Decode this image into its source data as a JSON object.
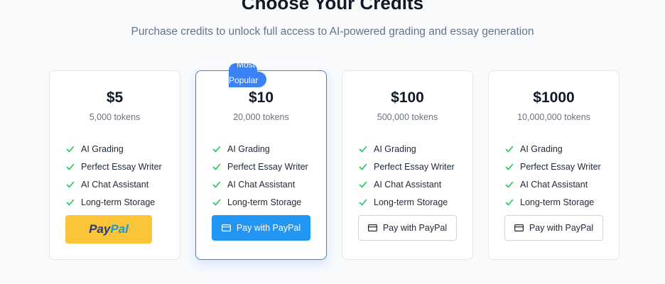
{
  "header": {
    "title": "Choose Your Credits",
    "subtitle": "Purchase credits to unlock full access to AI-powered grading and essay generation"
  },
  "plans": [
    {
      "price": "$5",
      "tokens": "5,000 tokens",
      "features": [
        "AI Grading",
        "Perfect Essay Writer",
        "AI Chat Assistant",
        "Long-term Storage"
      ],
      "button": {
        "pay": "Pay",
        "pal": "Pal"
      }
    },
    {
      "price": "$10",
      "tokens": "20,000 tokens",
      "badge_line1": "Most",
      "badge_line2": "Popular",
      "features": [
        "AI Grading",
        "Perfect Essay Writer",
        "AI Chat Assistant",
        "Long-term Storage"
      ],
      "button_label": "Pay with PayPal"
    },
    {
      "price": "$100",
      "tokens": "500,000 tokens",
      "features": [
        "AI Grading",
        "Perfect Essay Writer",
        "AI Chat Assistant",
        "Long-term Storage"
      ],
      "button_label": "Pay with PayPal"
    },
    {
      "price": "$1000",
      "tokens": "10,000,000 tokens",
      "features": [
        "AI Grading",
        "Perfect Essay Writer",
        "AI Chat Assistant",
        "Long-term Storage"
      ],
      "button_label": "Pay with PayPal"
    }
  ],
  "colors": {
    "accent": "#3b82f6",
    "check": "#22c55e",
    "paypal_yellow": "#fcc439",
    "primary_button": "#2196f3"
  },
  "icons": {
    "feature": "check-icon",
    "button": "credit-card-icon"
  }
}
